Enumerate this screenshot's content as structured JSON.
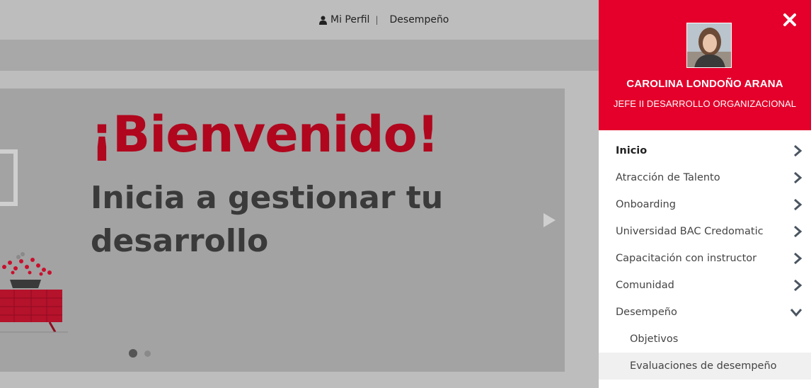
{
  "topnav": {
    "profile_label": "Mi Perfil",
    "separator": "|",
    "performance_label": "Desempeño"
  },
  "banner": {
    "title": "¡Bienvenido!",
    "subtitle": "Inicia a gestionar tu desarrollo"
  },
  "drawer": {
    "user_name": "CAROLINA LONDOÑO ARANA",
    "user_role": "JEFE II DESARROLLO ORGANIZACIONAL",
    "menu": [
      {
        "label": "Inicio"
      },
      {
        "label": "Atracción de Talento"
      },
      {
        "label": "Onboarding"
      },
      {
        "label": "Universidad BAC Credomatic"
      },
      {
        "label": "Capacitación con instructor"
      },
      {
        "label": "Comunidad"
      },
      {
        "label": "Desempeño"
      },
      {
        "label": "Objetivos"
      },
      {
        "label": "Evaluaciones de desempeño"
      }
    ]
  },
  "colors": {
    "brand_red": "#e4002b",
    "title_red": "#b0071e"
  }
}
